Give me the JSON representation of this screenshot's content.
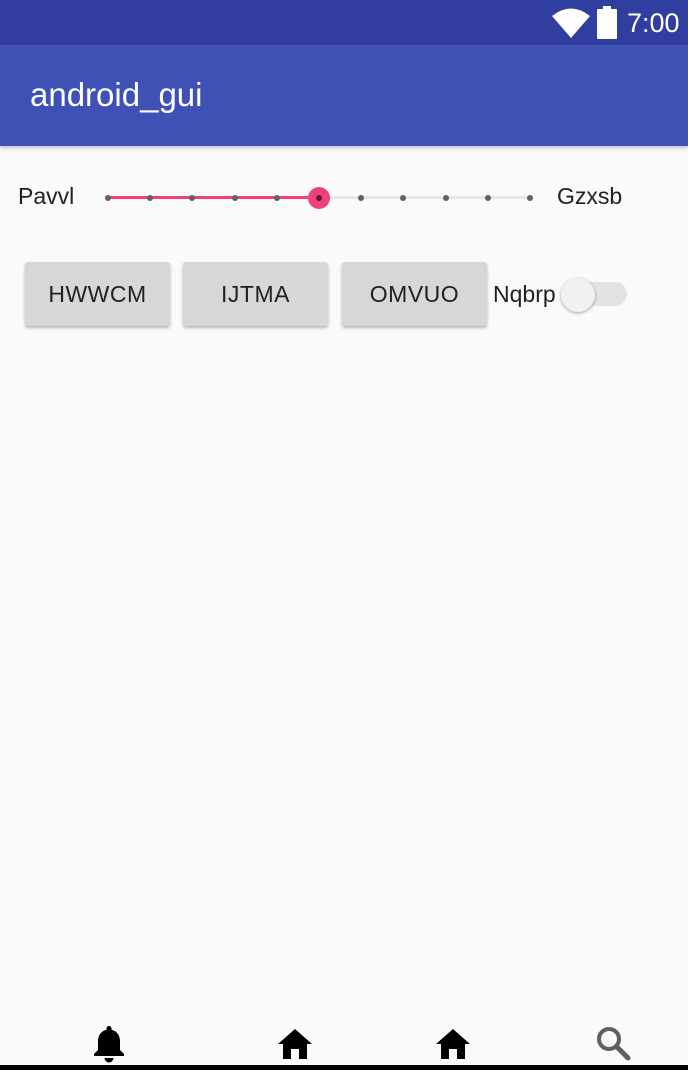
{
  "status_bar": {
    "time": "7:00",
    "icons": [
      "wifi-icon",
      "battery-icon"
    ]
  },
  "app_bar": {
    "title": "android_gui"
  },
  "slider": {
    "left_label": "Pavvl",
    "right_label": "Gzxsb",
    "steps": 10,
    "value": 5,
    "accent_color": "#ef407a"
  },
  "buttons": [
    {
      "label": "HWWCM"
    },
    {
      "label": "IJTMA"
    },
    {
      "label": "OMVUO"
    }
  ],
  "switch": {
    "label": "Nqbrp",
    "checked": false
  },
  "bottom_nav": {
    "items": [
      "bell-icon",
      "home-icon",
      "home-icon",
      "search-icon"
    ]
  },
  "colors": {
    "status_bar": "#303f9f",
    "app_bar": "#3f51b5",
    "background": "#fafafa"
  }
}
